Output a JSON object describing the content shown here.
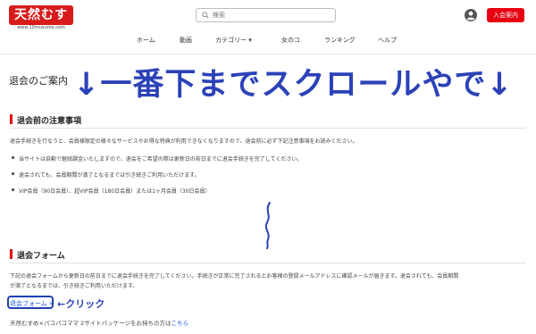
{
  "header": {
    "logo_text": "天然むすめ",
    "logo_subtext": "www.10musume.com",
    "search_placeholder": "検索",
    "join_button": "入会案内"
  },
  "nav": {
    "items": [
      "ホーム",
      "動画",
      "カテゴリー ▾",
      "女のコ",
      "ランキング",
      "ヘルプ"
    ]
  },
  "page": {
    "title": "退会のご案内",
    "overlay_annotation": "↓一番下までスクロールやで↓"
  },
  "notice": {
    "heading": "退会前の注意事項",
    "intro": "退会手続きを行なうと、会員様限定の様々なサービスやお得な特典が利用できなくなりますので、退会前に必ず下記注意事項をお読みください。",
    "bullets": [
      "当サイトは自動で継続課金いたしますので、退会をご希望の際は更新日の前日までに退会手続きを完了してください。",
      "退会されても、会員期間が満了となるまでは引き続きご利用いただけます。",
      "VIP会員（90日会員）、超VIP会員（180日会員）または1ヶ月会員（30日会員）"
    ]
  },
  "form": {
    "heading": "退会フォーム",
    "desc_line1": "下記の退会フォームから更新日の前日までに退会手続きを完了してください。手続きが正常に完了されるとお客様の登録メールアドレスに確認メールが届きます。退会されても、会員期間",
    "desc_line2": "が満了となるまでは、引き続きご利用いただけます。",
    "link_label": "退会フォーム »",
    "click_annotation": "←クリック",
    "package_note": "天然むすめ×パコパコママ 2サイトパッケージをお持ちの方は",
    "package_link": "こちら"
  }
}
